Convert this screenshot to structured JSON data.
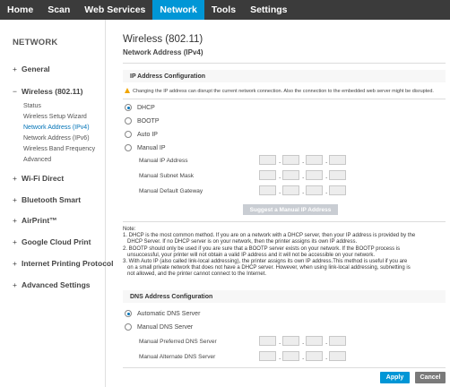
{
  "topnav": {
    "tabs": [
      "Home",
      "Scan",
      "Web Services",
      "Network",
      "Tools",
      "Settings"
    ],
    "active_tab": "Network"
  },
  "sidebar": {
    "title": "NETWORK",
    "general": "General",
    "wireless": "Wireless (802.11)",
    "wireless_items": [
      "Status",
      "Wireless Setup Wizard",
      "Network Address (IPv4)",
      "Network Address (IPv6)",
      "Wireless Band Frequency",
      "Advanced"
    ],
    "wifi_direct": "Wi-Fi Direct",
    "bluetooth": "Bluetooth Smart",
    "airprint": "AirPrint™",
    "gcp": "Google Cloud Print",
    "ipp": "Internet Printing Protocol",
    "advanced": "Advanced Settings",
    "plus": "+",
    "minus": "−"
  },
  "main": {
    "title": "Wireless (802.11)",
    "subtitle": "Network Address (IPv4)",
    "ip_section": {
      "heading": "IP Address Configuration",
      "warning": "Changing the IP address can disrupt the current network connection. Also the connection to the embedded web server might be disrupted.",
      "options": [
        "DHCP",
        "BOOTP",
        "Auto IP",
        "Manual IP"
      ],
      "selected": "DHCP",
      "fields": [
        "Manual IP Address",
        "Manual Subnet Mask",
        "Manual Default Gateway"
      ],
      "suggest_button": "Suggest a Manual IP Address"
    },
    "note": {
      "title": "Note:",
      "lines": [
        "1. DHCP is the most common method. If you are on a network with a DHCP server, then your IP address is provided by the",
        "DHCP Server. If no DHCP server is on your network, then the printer assigns its own IP address.",
        "2. BOOTP should only be used if you are sure that a BOOTP server exists on your network. If the BOOTP process is",
        "unsuccessful, your printer will not obtain a valid IP address and it will not be accessible on your network.",
        "3. With Auto IP (also called link-local addressing), the printer assigns its own IP address.This method is useful if you are",
        "on a small private network that does not have a DHCP server. However, when using link-local addressing, subnetting is",
        "not allowed, and the printer cannot connect to the Internet."
      ]
    },
    "dns_section": {
      "heading": "DNS Address Configuration",
      "options": [
        "Automatic DNS Server",
        "Manual DNS Server"
      ],
      "selected": "Automatic DNS Server",
      "fields": [
        "Manual Preferred DNS Server",
        "Manual Alternate DNS Server"
      ]
    },
    "apply_button": "Apply",
    "cancel_button": "Cancel",
    "dot": "."
  },
  "colors": {
    "accent": "#0096d6",
    "nav_bg": "#3b3b3b",
    "warning": "#f0a500",
    "cancel": "#7a7a7a"
  }
}
